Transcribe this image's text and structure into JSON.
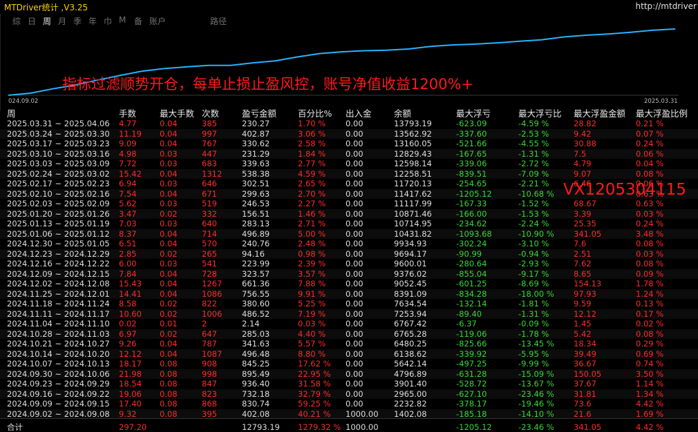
{
  "app": {
    "title": "MTDriver统计 ,V3.25",
    "url": "http://mtdriver"
  },
  "tabs": [
    {
      "label": "综",
      "active": false
    },
    {
      "label": "日",
      "active": false
    },
    {
      "label": "周",
      "active": true
    },
    {
      "label": "月",
      "active": false
    },
    {
      "label": "季",
      "active": false
    },
    {
      "label": "年",
      "active": false
    },
    {
      "label": "巾",
      "active": false
    },
    {
      "label": "M",
      "active": false
    },
    {
      "label": "备",
      "active": false
    },
    {
      "label": "账户",
      "active": false
    },
    {
      "label": "路径",
      "active": false
    }
  ],
  "chart": {
    "start_label": "024.09.02",
    "end_label": "2025.03.31",
    "annotation": "指标过滤顺势开仓，每单止损止盈风控，账号净值收益1200%+",
    "line_color": "#27b4ff"
  },
  "watermark": "VX1205304115",
  "headers": [
    "周",
    "手数",
    "最大手数",
    "次数",
    "盈亏金额",
    "百分比%",
    "出入金",
    "余额",
    "最大浮亏",
    "最大浮亏比",
    "最大浮盈金额",
    "最大浮盈比例"
  ],
  "rows": [
    [
      "2025.03.31 ~ 2025.04.06",
      "4.77",
      "0.04",
      "385",
      "230.27",
      "1.70 %",
      "0.00",
      "13793.19",
      "-623.09",
      "-4.59 %",
      "28.82",
      "0.21 %"
    ],
    [
      "2025.03.24 ~ 2025.03.30",
      "11.19",
      "0.04",
      "997",
      "402.87",
      "3.06 %",
      "0.00",
      "13562.92",
      "-337.60",
      "-2.53 %",
      "9.42",
      "0.07 %"
    ],
    [
      "2025.03.17 ~ 2025.03.23",
      "9.09",
      "0.04",
      "767",
      "330.62",
      "2.58 %",
      "0.00",
      "13160.05",
      "-521.66",
      "-4.55 %",
      "30.88",
      "0.24 %"
    ],
    [
      "2025.03.10 ~ 2025.03.16",
      "4.98",
      "0.03",
      "447",
      "231.29",
      "1.84 %",
      "0.00",
      "12829.43",
      "-167.65",
      "-1.31 %",
      "7.5",
      "0.06 %"
    ],
    [
      "2025.03.03 ~ 2025.03.09",
      "7.72",
      "0.03",
      "683",
      "339.63",
      "2.77 %",
      "0.00",
      "12598.14",
      "-339.06",
      "-2.72 %",
      "4.79",
      "0.04 %"
    ],
    [
      "2025.02.24 ~ 2025.03.02",
      "15.42",
      "0.04",
      "1312",
      "538.38",
      "4.59 %",
      "0.00",
      "12258.51",
      "-839.51",
      "-7.09 %",
      "9.07",
      "0.08 %"
    ],
    [
      "2025.02.17 ~ 2025.02.23",
      "6.94",
      "0.03",
      "646",
      "302.51",
      "2.65 %",
      "0.00",
      "11720.13",
      "-254.65",
      "-2.21 %",
      "6.46",
      "0.06 %"
    ],
    [
      "2025.02.10 ~ 2025.02.16",
      "7.54",
      "0.04",
      "671",
      "299.63",
      "2.70 %",
      "0.00",
      "11417.62",
      "-1205.12",
      "-10.68 %",
      "",
      "0.63 %"
    ],
    [
      "2025.02.03 ~ 2025.02.09",
      "5.62",
      "0.03",
      "519",
      "246.53",
      "2.27 %",
      "0.00",
      "11117.99",
      "-167.33",
      "-1.52 %",
      "68.67",
      "0.63 %"
    ],
    [
      "2025.01.20 ~ 2025.01.26",
      "3.47",
      "0.02",
      "332",
      "156.51",
      "1.46 %",
      "0.00",
      "10871.46",
      "-166.00",
      "-1.53 %",
      "3.39",
      "0.03 %"
    ],
    [
      "2025.01.13 ~ 2025.01.19",
      "7.03",
      "0.03",
      "640",
      "283.13",
      "2.71 %",
      "0.00",
      "10714.95",
      "-234.62",
      "-2.24 %",
      "25.35",
      "0.24 %"
    ],
    [
      "2025.01.06 ~ 2025.01.12",
      "8.37",
      "0.04",
      "714",
      "496.89",
      "5.00 %",
      "0.00",
      "10431.82",
      "-1093.68",
      "-10.90 %",
      "341.05",
      "3.48 %"
    ],
    [
      "2024.12.30 ~ 2025.01.05",
      "6.51",
      "0.04",
      "570",
      "240.76",
      "2.48 %",
      "0.00",
      "9934.93",
      "-302.24",
      "-3.10 %",
      "7.6",
      "0.08 %"
    ],
    [
      "2024.12.23 ~ 2024.12.29",
      "2.85",
      "0.02",
      "265",
      "94.16",
      "0.98 %",
      "0.00",
      "9694.17",
      "-90.99",
      "-0.94 %",
      "2.51",
      "0.03 %"
    ],
    [
      "2024.12.16 ~ 2024.12.22",
      "6.00",
      "0.03",
      "541",
      "223.99",
      "2.39 %",
      "0.00",
      "9600.01",
      "-280.64",
      "-2.93 %",
      "7.62",
      "0.08 %"
    ],
    [
      "2024.12.09 ~ 2024.12.15",
      "7.84",
      "0.04",
      "728",
      "323.57",
      "3.57 %",
      "0.00",
      "9376.02",
      "-855.04",
      "-9.17 %",
      "8.65",
      "0.09 %"
    ],
    [
      "2024.12.02 ~ 2024.12.08",
      "15.43",
      "0.04",
      "1267",
      "661.36",
      "7.88 %",
      "0.00",
      "9052.45",
      "-601.25",
      "-8.69 %",
      "154.13",
      "1.78 %"
    ],
    [
      "2024.11.25 ~ 2024.12.01",
      "14.41",
      "0.04",
      "1086",
      "756.55",
      "9.91 %",
      "0.00",
      "8391.09",
      "-834.28",
      "-18.00 %",
      "97.93",
      "1.24 %"
    ],
    [
      "2024.11.18 ~ 2024.11.24",
      "8.58",
      "0.02",
      "822",
      "380.60",
      "5.25 %",
      "0.00",
      "7634.54",
      "-132.14",
      "-1.81 %",
      "9.59",
      "0.13 %"
    ],
    [
      "2024.11.11 ~ 2024.11.17",
      "10.60",
      "0.02",
      "1006",
      "486.52",
      "7.19 %",
      "0.00",
      "7253.94",
      "-89.40",
      "-1.31 %",
      "12.12",
      "0.17 %"
    ],
    [
      "2024.11.04 ~ 2024.11.10",
      "0.02",
      "0.01",
      "2",
      "2.14",
      "0.03 %",
      "0.00",
      "6767.42",
      "-6.37",
      "-0.09 %",
      "1.45",
      "0.02 %"
    ],
    [
      "2024.10.28 ~ 2024.11.03",
      "6.97",
      "0.02",
      "647",
      "285.03",
      "4.40 %",
      "0.00",
      "6765.28",
      "-119.06",
      "-1.78 %",
      "5.42",
      "0.08 %"
    ],
    [
      "2024.10.21 ~ 2024.10.27",
      "9.26",
      "0.04",
      "787",
      "341.63",
      "5.57 %",
      "0.00",
      "6480.25",
      "-825.66",
      "-13.45 %",
      "18.34",
      "0.29 %"
    ],
    [
      "2024.10.14 ~ 2024.10.20",
      "12.12",
      "0.04",
      "1087",
      "496.48",
      "8.80 %",
      "0.00",
      "6138.62",
      "-339.92",
      "-5.95 %",
      "39.49",
      "0.69 %"
    ],
    [
      "2024.10.07 ~ 2024.10.13",
      "18.17",
      "0.08",
      "908",
      "845.25",
      "17.62 %",
      "0.00",
      "5642.14",
      "-497.25",
      "-9.99 %",
      "36.67",
      "0.74 %"
    ],
    [
      "2024.09.30 ~ 2024.10.06",
      "21.98",
      "0.08",
      "998",
      "895.49",
      "22.95 %",
      "0.00",
      "4796.89",
      "-631.28",
      "-15.09 %",
      "150.05",
      "3.50 %"
    ],
    [
      "2024.09.23 ~ 2024.09.29",
      "18.54",
      "0.08",
      "847",
      "936.40",
      "31.58 %",
      "0.00",
      "3901.40",
      "-528.72",
      "-13.67 %",
      "37.67",
      "1.14 %"
    ],
    [
      "2024.09.16 ~ 2024.09.22",
      "19.06",
      "0.08",
      "823",
      "732.18",
      "32.79 %",
      "0.00",
      "2965.00",
      "-627.10",
      "-23.46 %",
      "31.81",
      "1.34 %"
    ],
    [
      "2024.09.09 ~ 2024.09.15",
      "17.40",
      "0.08",
      "868",
      "830.74",
      "59.25 %",
      "0.00",
      "2232.82",
      "-378.17",
      "-19.46 %",
      "73.6",
      "4.42 %"
    ],
    [
      "2024.09.02 ~ 2024.09.08",
      "9.32",
      "0.08",
      "395",
      "402.08",
      "40.21 %",
      "1000.00",
      "1402.08",
      "-185.18",
      "-14.10 %",
      "21.6",
      "1.69 %"
    ]
  ],
  "total": [
    "合计",
    "297.20",
    "",
    "",
    "12793.19",
    "1279.32 %",
    "1000.00",
    "",
    "-1205.12",
    "-23.46 %",
    "341.05",
    "4.42 %"
  ],
  "balance_series": [
    1000,
    1402.08,
    2232.82,
    2965.0,
    3901.4,
    4796.89,
    5642.14,
    6138.62,
    6480.25,
    6765.28,
    6767.42,
    7253.94,
    7634.54,
    8391.09,
    9052.45,
    9376.02,
    9600.01,
    9694.17,
    9934.93,
    10431.82,
    10714.95,
    10871.46,
    11117.99,
    11417.62,
    11720.13,
    12258.51,
    12598.14,
    12829.43,
    13160.05,
    13562.92,
    13793.19
  ]
}
